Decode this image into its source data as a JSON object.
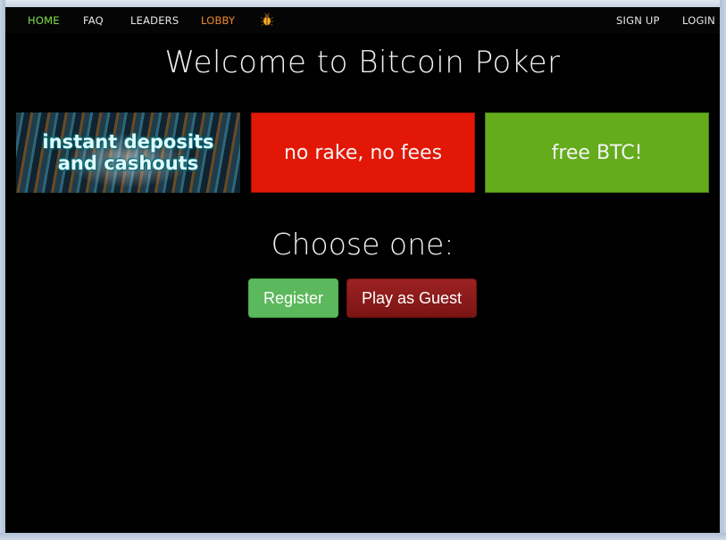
{
  "nav": {
    "home": "HOME",
    "faq": "FAQ",
    "leaders": "LEADERS",
    "lobby": "LOBBY",
    "bug_icon": "bug-icon",
    "signup": "SIGN UP",
    "login": "LOGIN"
  },
  "main": {
    "title": "Welcome to Bitcoin Poker",
    "banners": [
      {
        "text_line1": "instant deposits",
        "text_line2": "and cashouts"
      },
      {
        "text": "no rake, no fees",
        "color": "#e21705"
      },
      {
        "text": "free BTC!",
        "color": "#64ac1c"
      }
    ],
    "choose": "Choose one:",
    "register_label": "Register",
    "guest_label": "Play as Guest"
  },
  "colors": {
    "home_active": "#7fe04d",
    "lobby": "#f08a2c",
    "register_button": "#5cb85c",
    "guest_button": "#8e1c1c"
  }
}
